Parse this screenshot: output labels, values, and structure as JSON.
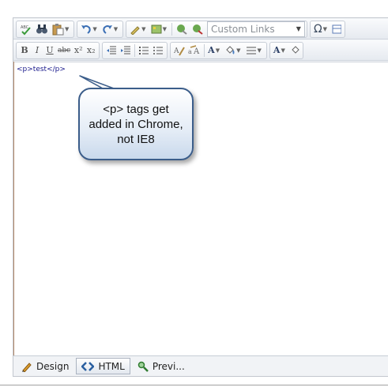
{
  "toolbar": {
    "custom_links_select": "Custom Links",
    "special_char_glyph": "Ω",
    "bold_glyph": "B",
    "italic_glyph": "I",
    "underline_glyph": "U",
    "strike_glyph": "abc",
    "superscript_glyph": "x²",
    "subscript_glyph": "x₂",
    "forecolor_glyph": "A",
    "backcolor_glyph": "A"
  },
  "editor": {
    "content": "<p>test</p>"
  },
  "annotation": {
    "text": "<p> tags get added in Chrome, not IE8"
  },
  "tabs": [
    {
      "label": "Design",
      "icon": "pencil-icon",
      "active": false
    },
    {
      "label": "HTML",
      "icon": "code-icon",
      "active": true
    },
    {
      "label": "Previ...",
      "icon": "magnifier-icon",
      "active": false
    }
  ],
  "colors": {
    "callout_border": "#3b5d8a",
    "editor_text": "#1a1a8c",
    "toolbar_bg": "#e6eaf0"
  }
}
